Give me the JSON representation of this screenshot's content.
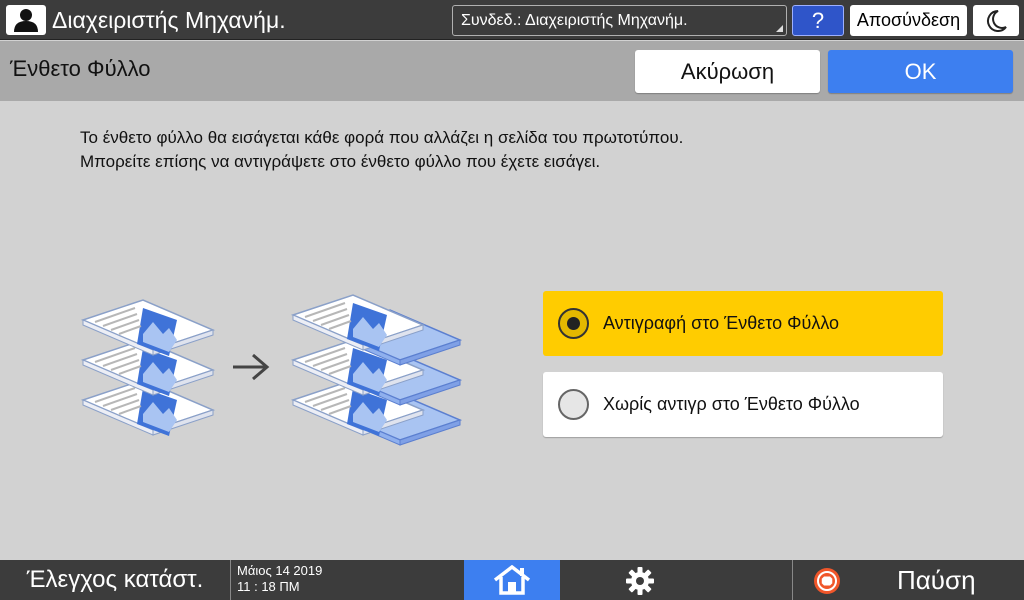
{
  "topbar": {
    "title": "Διαχειριστής Μηχανήμ.",
    "user_select": "Συνδεδ.: Διαχειριστής Μηχανήμ.",
    "help_label": "?",
    "logout_label": "Αποσύνδεση"
  },
  "titlebar": {
    "title": "Ένθετο Φύλλο",
    "cancel_label": "Ακύρωση",
    "ok_label": "OK"
  },
  "main": {
    "description_line1": "Το ένθετο φύλλο θα εισάγεται κάθε φορά που αλλάζει η σελίδα του πρωτοτύπου.",
    "description_line2": "Μπορείτε επίσης να αντιγράψετε στο ένθετο φύλλο που έχετε εισάγει.",
    "options": [
      {
        "label": "Αντιγραφή στο Ένθετο Φύλλο",
        "selected": true
      },
      {
        "label": "Χωρίς αντιγρ στο Ένθετο Φύλλο",
        "selected": false
      }
    ]
  },
  "bottombar": {
    "status_label": "Έλεγχος κατάστ.",
    "date": "Μάιος 14 2019",
    "time": "11 : 18 ΠΜ",
    "stop_label": "Παύση"
  },
  "colors": {
    "accent_blue": "#3d7ff0",
    "selected_yellow": "#ffcc00",
    "bar_dark": "#3c3c3c"
  },
  "icons": [
    "user-icon",
    "moon-icon",
    "home-icon",
    "gear-icon",
    "stop-icon",
    "arrow-right-icon"
  ]
}
